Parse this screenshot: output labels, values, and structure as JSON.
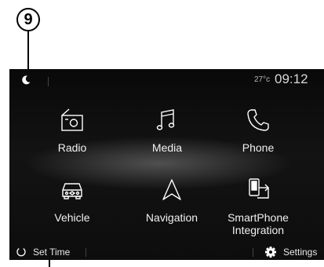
{
  "callout": {
    "number": "9"
  },
  "status_bar": {
    "mode_icon": "moon-icon",
    "temperature": "27°c",
    "time": "09:12"
  },
  "menu": {
    "items": [
      {
        "label": "Radio",
        "icon": "radio-icon"
      },
      {
        "label": "Media",
        "icon": "music-note-icon"
      },
      {
        "label": "Phone",
        "icon": "phone-icon"
      },
      {
        "label": "Vehicle",
        "icon": "car-icon"
      },
      {
        "label": "Navigation",
        "icon": "navigation-arrow-icon"
      },
      {
        "label": "SmartPhone Integration",
        "icon": "smartphone-share-icon"
      }
    ]
  },
  "bottom_bar": {
    "set_time": {
      "label": "Set Time",
      "icon": "power-ring-icon"
    },
    "settings": {
      "label": "Settings",
      "icon": "gear-icon"
    }
  },
  "colors": {
    "screen_background": "#0b0b0b",
    "text": "#f0f0f0",
    "callout": "#000000"
  }
}
